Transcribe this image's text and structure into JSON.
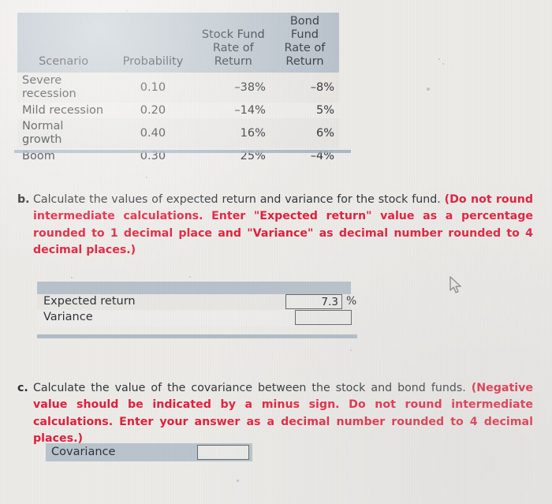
{
  "table": {
    "headers": {
      "scenario": "Scenario",
      "probability": "Probability",
      "stock_fund": "Stock Fund\nRate of\nReturn",
      "stock_fund_line1": "Stock Fund",
      "stock_fund_line2": "Rate of",
      "stock_fund_line3": "Return",
      "bond_fund_line1": "Bond Fund",
      "bond_fund_line2": "Rate of",
      "bond_fund_line3": "Return"
    },
    "rows": [
      {
        "scenario": "Severe recession",
        "probability": "0.10",
        "stock": "–38%",
        "bond": "–8%"
      },
      {
        "scenario": "Mild recession",
        "probability": "0.20",
        "stock": "–14%",
        "bond": "5%"
      },
      {
        "scenario": "Normal growth",
        "probability": "0.40",
        "stock": "16%",
        "bond": "6%"
      },
      {
        "scenario": "Boom",
        "probability": "0.30",
        "stock": "25%",
        "bond": "–4%"
      }
    ]
  },
  "question_b": {
    "marker": "b.",
    "plain": "Calculate the values of expected return and variance for the stock fund. ",
    "red": "(Do not round intermediate calculations. Enter \"Expected return\" value as a percentage rounded to 1 decimal place and \"Variance\" as decimal number rounded to 4 decimal places.)"
  },
  "question_c": {
    "marker": "c.",
    "plain": "Calculate the value of the covariance between the stock and bond funds. ",
    "red": "(Negative value should be indicated by a minus sign. Do not round intermediate calculations. Enter your answer as a decimal number rounded to 4 decimal places.)"
  },
  "answer_b": {
    "expected_return_label": "Expected return",
    "expected_return_value": "7.3",
    "expected_return_unit": "%",
    "variance_label": "Variance",
    "variance_value": ""
  },
  "answer_c": {
    "covariance_label": "Covariance",
    "covariance_value": ""
  },
  "colors": {
    "paper": "#eceae7",
    "header_band": "#b7c1c9",
    "rule": "#9fb0be",
    "red_text": "#e01f3d",
    "body_text": "#2b2f33"
  },
  "cursor": {
    "icon": "mouse-pointer-icon"
  }
}
